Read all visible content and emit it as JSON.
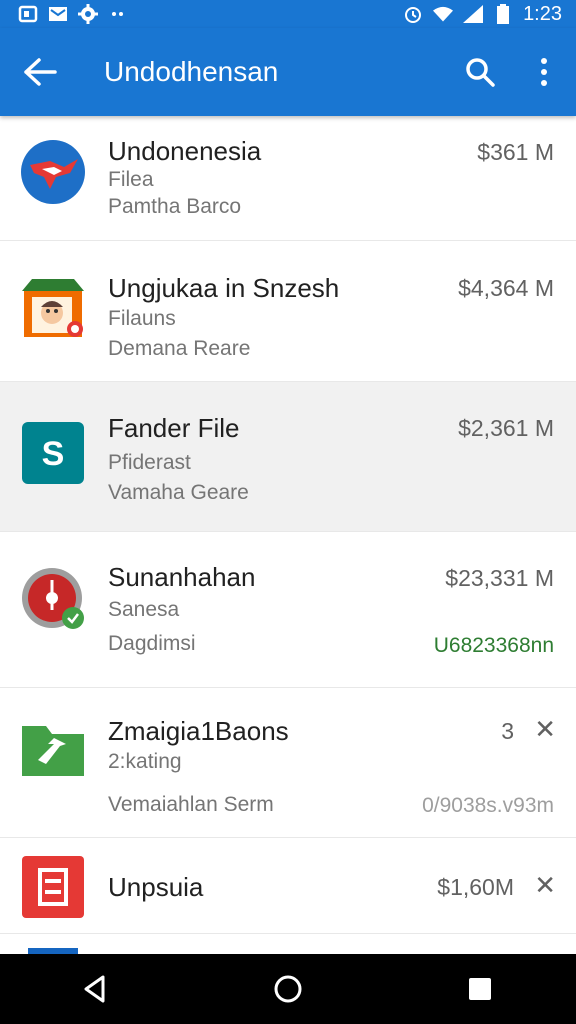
{
  "status_bar": {
    "time": "1:23",
    "left_icons": [
      "screenshot-icon",
      "mail-icon",
      "settings-icon",
      "more-dots-icon"
    ],
    "right_icons": [
      "alarm-icon",
      "wifi-icon",
      "signal-icon",
      "battery-icon"
    ]
  },
  "app_bar": {
    "title": "Undodhensan",
    "color": "#1976d2"
  },
  "items": [
    {
      "title": "Undonenesia",
      "subtitle": "Filea",
      "detail": "Pamtha Barco",
      "amount": "$361 M",
      "icon": "indonesia-map-icon"
    },
    {
      "title": "Ungjukaa in Snzesh",
      "subtitle": "Filauns",
      "detail": "Demana Reare",
      "amount": "$4,364 M",
      "icon": "storefront-avatar-icon"
    },
    {
      "title": "Fander File",
      "subtitle": "Pfiderast",
      "detail": "Vamaha Geare",
      "amount": "$2,361 M",
      "icon": "dollar-app-icon"
    },
    {
      "title": "Sunanhahan",
      "subtitle": "Sanesa",
      "detail": "Dagdimsi",
      "amount": "$23,331 M",
      "side": "U6823368nn",
      "icon": "clock-badge-icon"
    },
    {
      "title": "Zmaigia1Baons",
      "subtitle": "2:kating",
      "detail": "Vemaiahlan Serm",
      "amount": "3",
      "side": "0/9038s.v93m",
      "icon": "green-folder-icon"
    },
    {
      "title": "Unpsuia",
      "amount": "$1,60M",
      "icon": "red-document-icon"
    }
  ],
  "nav": {
    "back_icon": "nav-back-icon",
    "home_icon": "nav-home-icon",
    "recents_icon": "nav-recents-icon"
  }
}
